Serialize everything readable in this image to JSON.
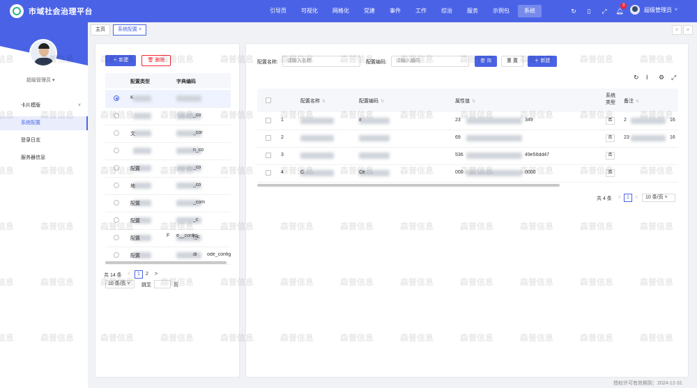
{
  "app": {
    "title": "市域社会治理平台"
  },
  "nav": [
    "引导页",
    "可视化",
    "网格化",
    "党建",
    "事件",
    "工作",
    "综治",
    "服务",
    "示例包",
    "系统"
  ],
  "nav_active": 9,
  "header_icons": [
    "refresh-icon",
    "mobile-icon",
    "fullscreen-icon",
    "bell-icon"
  ],
  "notify_count": "3",
  "user": {
    "name": "超级管理员"
  },
  "sidebar": {
    "user": "超级管理员",
    "items": [
      {
        "label": "卡片模版",
        "arrow": "˅"
      },
      {
        "label": "系统配置"
      },
      {
        "label": "登录日志"
      },
      {
        "label": "服务器信息"
      }
    ],
    "active": 1
  },
  "tabs": [
    {
      "label": "主页"
    },
    {
      "label": "系统配置",
      "close": "×"
    }
  ],
  "left_panel": {
    "new_label": "＋ 新建",
    "delete_label": "删除",
    "columns": [
      "配置类型",
      "字典编码"
    ],
    "rows": [
      {
        "type": "K",
        "code": "",
        "selected": true
      },
      {
        "type": "",
        "code": "_co"
      },
      {
        "type": "文",
        "code": "_cor"
      },
      {
        "type": "",
        "code": "配置",
        "code2": "n_co"
      },
      {
        "type": "配置",
        "code": "_co"
      },
      {
        "type": "地",
        "code": "_co"
      },
      {
        "type": "配置",
        "code": "_com"
      },
      {
        "type": "配置",
        "code": "_c"
      },
      {
        "type": "配置",
        "code": "f_c"
      },
      {
        "type": "配置",
        "code": "di",
        "code_tail": "ode_config"
      }
    ],
    "row7_extra": "e__config",
    "row7_prefix": "F",
    "pager": {
      "total": "共 14 条",
      "pages": [
        "1",
        "2"
      ],
      "size": "10 条/页",
      "jump": "跳至",
      "page_unit": "页",
      "prev": "<",
      "next": ">"
    }
  },
  "right_panel": {
    "search": {
      "name_label": "配置名称:",
      "name_placeholder": "请输入名称",
      "code_label": "配置编码:",
      "code_placeholder": "请输入编码",
      "query_label": "查 询",
      "reset_label": "重 置",
      "new_label": "＋ 新建"
    },
    "columns": [
      "配置名称",
      "配置编码",
      "属性值",
      "系统类型",
      "备注"
    ],
    "rows": [
      {
        "idx": "1",
        "name": "",
        "code": "ir",
        "value": "23",
        "value_tail": "349",
        "sys": "否",
        "note": "2",
        "note_tail": "16"
      },
      {
        "idx": "2",
        "name": "",
        "code": "",
        "value": "69",
        "value_tail": "",
        "sys": "否",
        "note": "23",
        "note_tail": "16"
      },
      {
        "idx": "3",
        "name": "",
        "code": "",
        "value": "536",
        "value_tail": "49e56dd47",
        "sys": "否",
        "note": "",
        "note_tail": ""
      },
      {
        "idx": "4",
        "name": "C",
        "code": "Ce",
        "value": "000",
        "value_tail": "0000",
        "sys": "否",
        "note": "",
        "note_tail": ""
      }
    ],
    "pager": {
      "total": "共 4 条",
      "page": "1",
      "size": "10 条/页",
      "prev": "<",
      "next": ">"
    }
  },
  "watermark": "森普信息",
  "footer": "授权许可有效期到：2024-12-31"
}
